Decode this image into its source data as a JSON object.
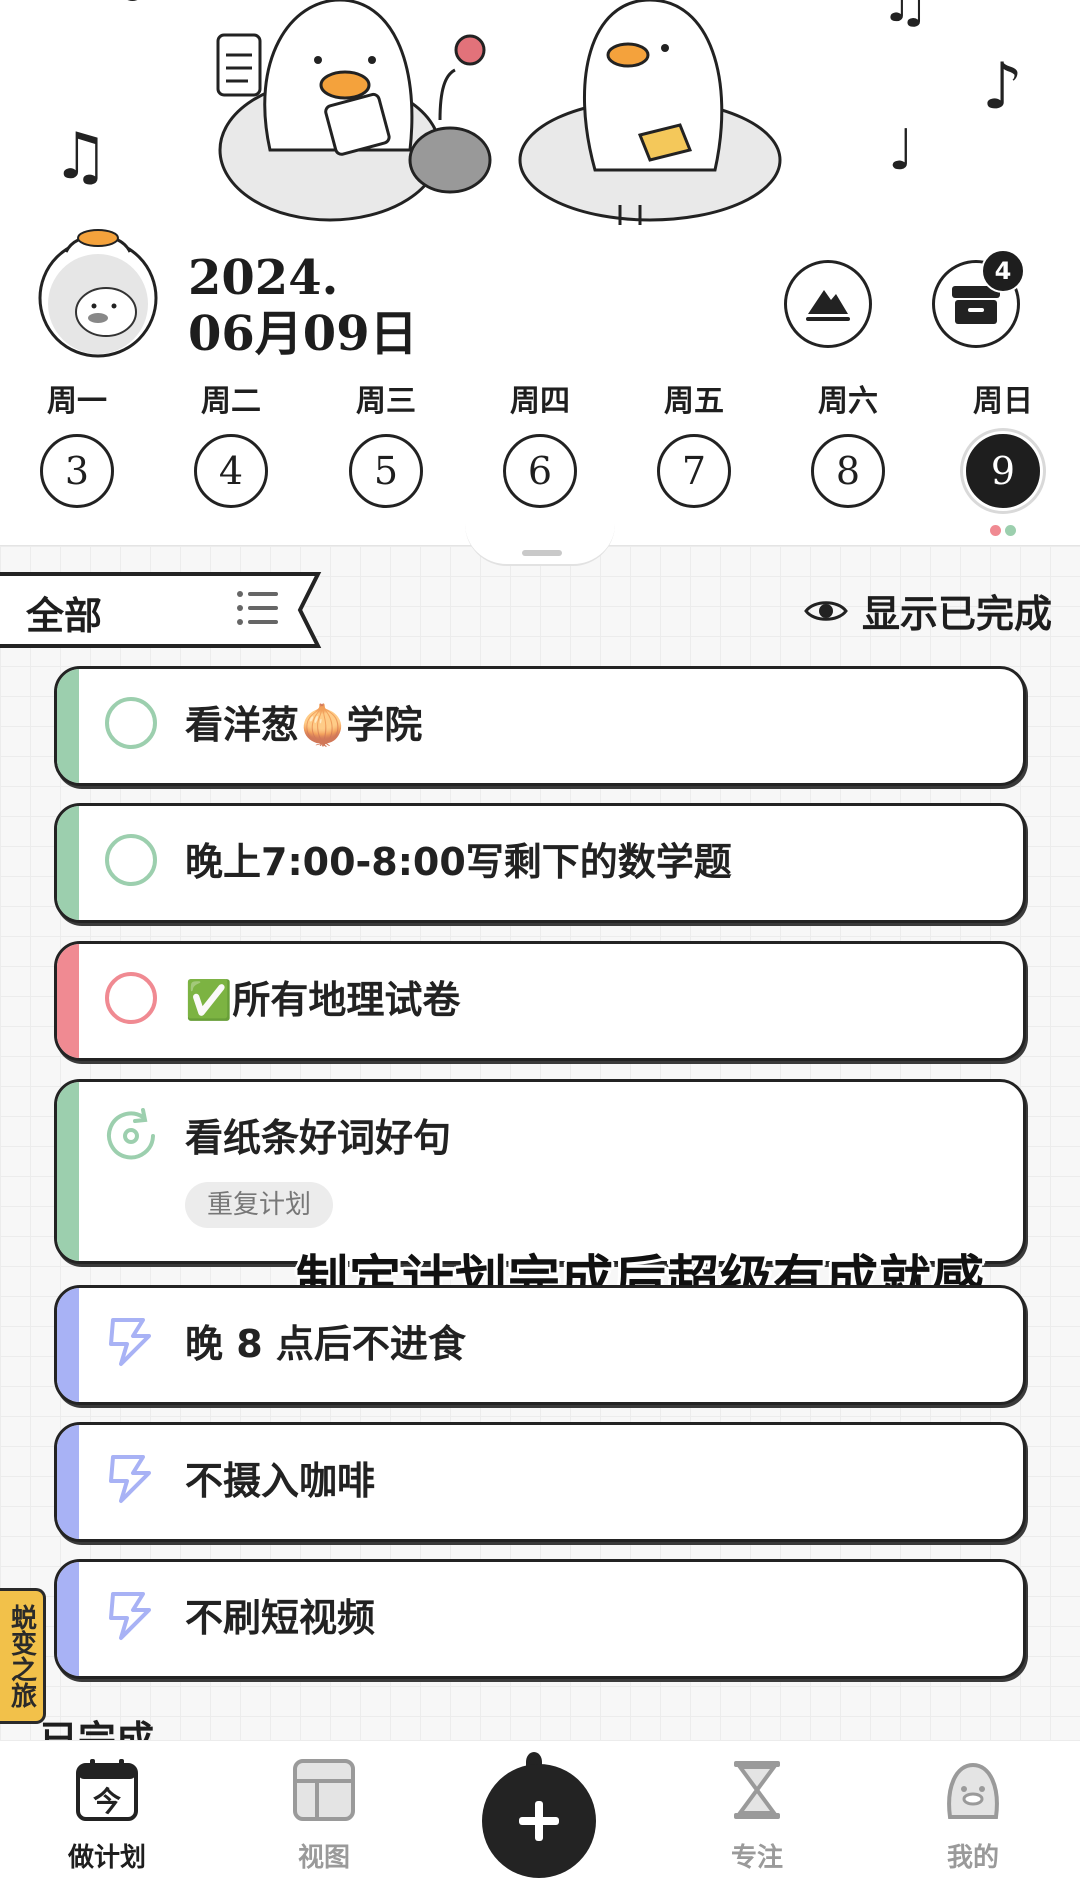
{
  "header": {
    "date_year": "2024.",
    "date_day": "06月09日",
    "inbox_badge": "4"
  },
  "week": [
    {
      "label": "周一",
      "day": "3"
    },
    {
      "label": "周二",
      "day": "4"
    },
    {
      "label": "周三",
      "day": "5"
    },
    {
      "label": "周四",
      "day": "6"
    },
    {
      "label": "周五",
      "day": "7"
    },
    {
      "label": "周六",
      "day": "8"
    },
    {
      "label": "周日",
      "day": "9",
      "selected": true
    }
  ],
  "filter": {
    "label": "全部",
    "show_completed_label": "显示已完成"
  },
  "tasks": [
    {
      "title": "看洋葱🧅学院",
      "icon": "circle-checkbox",
      "color": "#9ccfae"
    },
    {
      "title": "晚上7:00-8:00写剩下的数学题",
      "icon": "circle-checkbox",
      "color": "#9ccfae"
    },
    {
      "title": "✅所有地理试卷",
      "icon": "circle-checkbox",
      "color": "#f08a92"
    },
    {
      "title": "看纸条好词好句",
      "icon": "repeat-icon",
      "color": "#9ccfae",
      "tag": "重复计划"
    },
    {
      "title": "晚 8 点后不进食",
      "icon": "lightning-icon",
      "color": "#a8b2f5"
    },
    {
      "title": "不摄入咖啡",
      "icon": "lightning-icon",
      "color": "#a8b2f5"
    },
    {
      "title": "不刷短视频",
      "icon": "lightning-icon",
      "color": "#a8b2f5"
    }
  ],
  "caption": "制定计划完成后超级有成就感",
  "side_tab": "蜕变之旅",
  "completed_section": "已完成",
  "nav": {
    "plan": "做计划",
    "plan_icon_text": "今",
    "view": "视图",
    "focus": "专注",
    "me": "我的"
  },
  "colors": {
    "dark": "#232323",
    "green_accent": "#9ccfae",
    "red_accent": "#f08a92",
    "purple_accent": "#a8b2f5",
    "badge_tab": "#f2c14a"
  }
}
